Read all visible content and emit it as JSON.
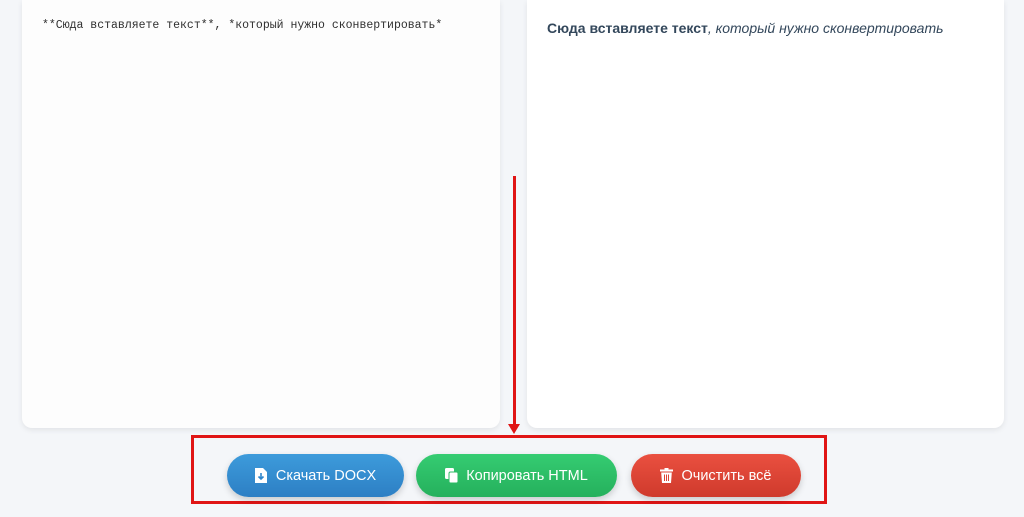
{
  "editor": {
    "content": "**Сюда вставляете текст**, *который нужно сконвертировать*"
  },
  "preview": {
    "bold_text": "Сюда вставляете текст",
    "italic_text": ", который нужно сконвертировать"
  },
  "actions": {
    "download_docx_label": "Скачать DOCX",
    "copy_html_label": "Копировать HTML",
    "clear_all_label": "Очистить всё"
  },
  "icons": {
    "download": "file-download-icon",
    "copy": "copy-icon",
    "clear": "trash-icon"
  },
  "colors": {
    "docx_button": "#2f86cc",
    "html_button": "#2ebd66",
    "clear_button": "#dd4434",
    "annotation": "#e01515"
  }
}
